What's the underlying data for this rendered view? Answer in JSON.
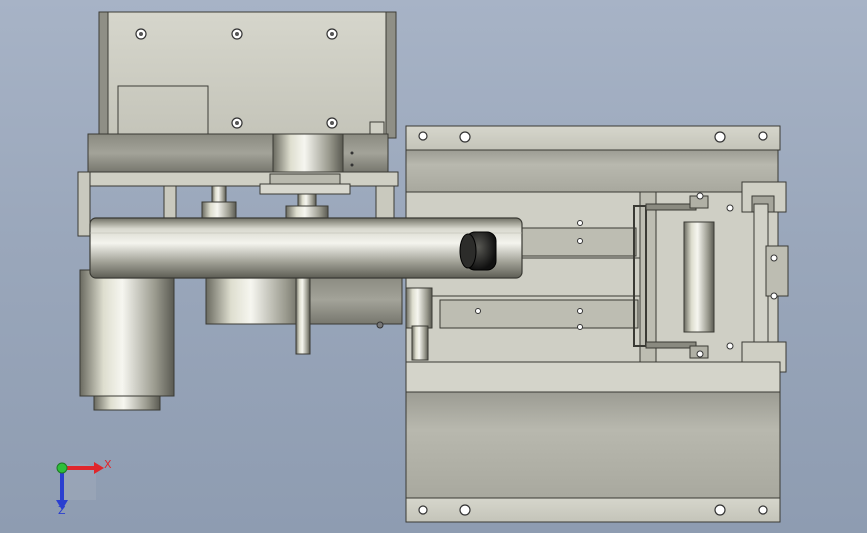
{
  "view": {
    "background_top": "#a7b3c6",
    "background_bottom": "#8e9cb1"
  },
  "triad": {
    "x_label": "X",
    "z_label": "Z",
    "x_color": "#e0262b",
    "y_color": "#2fbf3a",
    "z_color": "#2a3fd0"
  }
}
